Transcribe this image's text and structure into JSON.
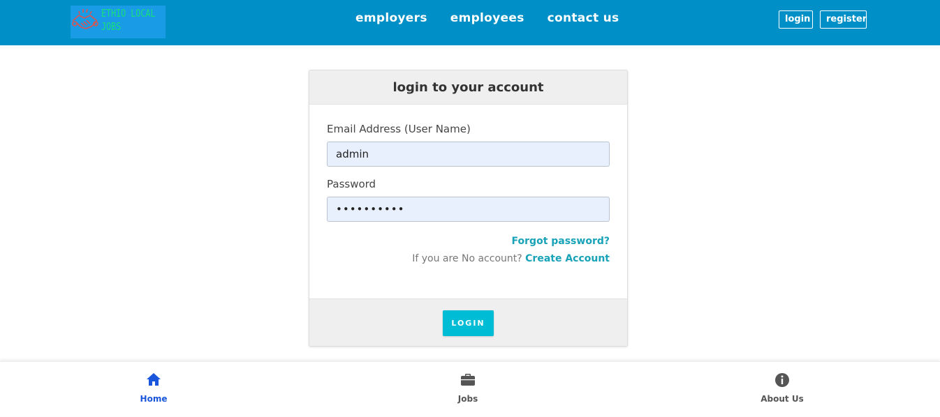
{
  "header": {
    "logo": {
      "line1": "ETHIO LOCAL",
      "line2": "JOBS",
      "icon": "handshake-icon"
    },
    "nav": [
      "employers",
      "employees",
      "contact us"
    ],
    "login_label": "login",
    "register_label": "register"
  },
  "login_card": {
    "title": "login to your account",
    "email_label": "Email Address (User Name)",
    "email_value": "admin",
    "password_label": "Password",
    "password_value": "••••••••••",
    "forgot_link": "Forgot password?",
    "no_account_text": "If you are No account?",
    "create_link": "Create Account",
    "login_button": "LOGIN"
  },
  "bottom_nav": {
    "items": [
      {
        "label": "Home",
        "icon": "home-icon",
        "active": true
      },
      {
        "label": "Jobs",
        "icon": "briefcase-icon",
        "active": false
      },
      {
        "label": "About Us",
        "icon": "info-icon",
        "active": false
      }
    ]
  },
  "colors": {
    "header_bg": "#008fc6",
    "accent": "#17a2b8",
    "login_button": "#00bcd4",
    "active_nav": "#1a56db",
    "input_bg": "#e8f0fe"
  }
}
